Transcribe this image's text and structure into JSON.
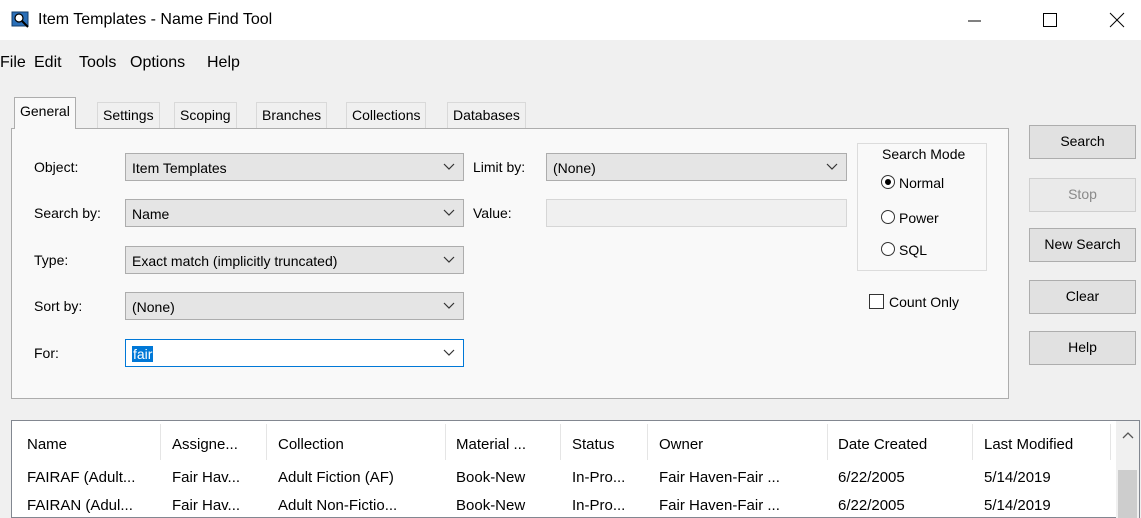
{
  "window": {
    "title": "Item Templates - Name Find Tool"
  },
  "menu": [
    "File",
    "Edit",
    "Tools",
    "Options",
    "Help"
  ],
  "tabs": [
    "General",
    "Settings",
    "Scoping",
    "Branches",
    "Collections",
    "Databases"
  ],
  "form": {
    "object_label": "Object:",
    "object_value": "Item Templates",
    "search_by_label": "Search by:",
    "search_by_value": "Name",
    "type_label": "Type:",
    "type_value": "Exact match (implicitly truncated)",
    "sort_by_label": "Sort by:",
    "sort_by_value": "(None)",
    "for_label": "For:",
    "for_value": "fair",
    "limit_by_label": "Limit by:",
    "limit_by_value": "(None)",
    "value_label": "Value:",
    "value_value": ""
  },
  "search_mode": {
    "title": "Search Mode",
    "options": [
      "Normal",
      "Power",
      "SQL"
    ],
    "selected": "Normal"
  },
  "count_only": {
    "label": "Count Only",
    "checked": false
  },
  "buttons": {
    "search": "Search",
    "stop": "Stop",
    "new_search": "New Search",
    "clear": "Clear",
    "help": "Help"
  },
  "results": {
    "columns": [
      "Name",
      "Assigne...",
      "Collection",
      "Material ...",
      "Status",
      "Owner",
      "Date Created",
      "Last Modified"
    ],
    "rows": [
      [
        "FAIRAF (Adult...",
        "Fair Hav...",
        "Adult Fiction (AF)",
        "Book-New",
        "In-Pro...",
        "Fair Haven-Fair ...",
        "6/22/2005",
        "5/14/2019"
      ],
      [
        "FAIRAN (Adul...",
        "Fair Hav...",
        "Adult Non-Fictio...",
        "Book-New",
        "In-Pro...",
        "Fair Haven-Fair ...",
        "6/22/2005",
        "5/14/2019"
      ]
    ]
  },
  "colors": {
    "accent": "#0078d7",
    "window_bg": "#f0f0f0"
  }
}
